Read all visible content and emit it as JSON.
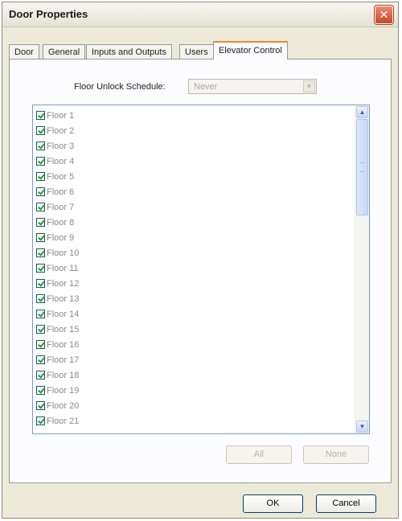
{
  "window": {
    "title": "Door Properties",
    "close_glyph": "✕"
  },
  "tabs": [
    {
      "label": "Door"
    },
    {
      "label": "General"
    },
    {
      "label": "Inputs and Outputs"
    },
    {
      "label": "Users"
    },
    {
      "label": "Elevator Control"
    }
  ],
  "active_tab": "Elevator Control",
  "schedule": {
    "label": "Floor Unlock Schedule:",
    "value": "Never",
    "arrow_icon": "chevron-down-icon"
  },
  "floors": [
    {
      "label": "Floor 1",
      "checked": true
    },
    {
      "label": "Floor 2",
      "checked": true
    },
    {
      "label": "Floor 3",
      "checked": true
    },
    {
      "label": "Floor 4",
      "checked": true
    },
    {
      "label": "Floor 5",
      "checked": true
    },
    {
      "label": "Floor 6",
      "checked": true
    },
    {
      "label": "Floor 7",
      "checked": true
    },
    {
      "label": "Floor 8",
      "checked": true
    },
    {
      "label": "Floor 9",
      "checked": true
    },
    {
      "label": "Floor 10",
      "checked": true
    },
    {
      "label": "Floor 11",
      "checked": true
    },
    {
      "label": "Floor 12",
      "checked": true
    },
    {
      "label": "Floor 13",
      "checked": true
    },
    {
      "label": "Floor 14",
      "checked": true
    },
    {
      "label": "Floor 15",
      "checked": true
    },
    {
      "label": "Floor 16",
      "checked": true
    },
    {
      "label": "Floor 17",
      "checked": true
    },
    {
      "label": "Floor 18",
      "checked": true
    },
    {
      "label": "Floor 19",
      "checked": true
    },
    {
      "label": "Floor 20",
      "checked": true
    },
    {
      "label": "Floor 21",
      "checked": true
    }
  ],
  "scroll": {
    "up_glyph": "▲",
    "down_glyph": "▼"
  },
  "buttons": {
    "all": "All",
    "none": "None",
    "ok": "OK",
    "cancel": "Cancel"
  },
  "colors": {
    "accent_tab": "#e68b2c",
    "close_button": "#c9462c",
    "check": "#21a121"
  }
}
